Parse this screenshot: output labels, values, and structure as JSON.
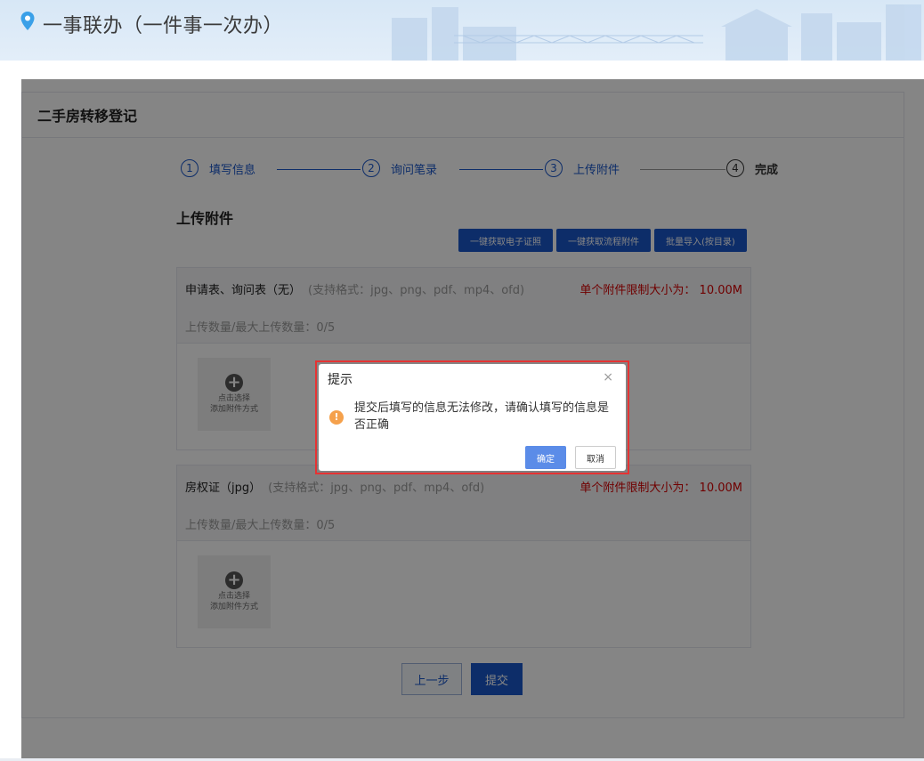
{
  "header": {
    "title": "一事联办（一件事一次办）"
  },
  "card": {
    "title": "二手房转移登记"
  },
  "steps": [
    {
      "num": "1",
      "label": "填写信息"
    },
    {
      "num": "2",
      "label": "询问笔录"
    },
    {
      "num": "3",
      "label": "上传附件"
    },
    {
      "num": "4",
      "label": "完成"
    }
  ],
  "section": {
    "title": "上传附件",
    "buttons": [
      "一键获取电子证照",
      "一键获取流程附件",
      "批量导入(按目录)"
    ]
  },
  "attachments": [
    {
      "name": "申请表、询问表（无）",
      "formats": "(支持格式：jpg、png、pdf、mp4、ofd)",
      "limit": "单个附件限制大小为：  10.00M",
      "count": "上传数量/最大上传数量：0/5",
      "upload_line1": "点击选择",
      "upload_line2": "添加附件方式"
    },
    {
      "name": "房权证（jpg）",
      "formats": "(支持格式：jpg、png、pdf、mp4、ofd)",
      "limit": "单个附件限制大小为：  10.00M",
      "count": "上传数量/最大上传数量：0/5",
      "upload_line1": "点击选择",
      "upload_line2": "添加附件方式"
    }
  ],
  "nav": {
    "prev": "上一步",
    "submit": "提交"
  },
  "dialog": {
    "title": "提示",
    "close": "×",
    "icon": "!",
    "message": "提交后填写的信息无法修改，请确认填写的信息是否正确",
    "ok": "确定",
    "cancel": "取消"
  }
}
